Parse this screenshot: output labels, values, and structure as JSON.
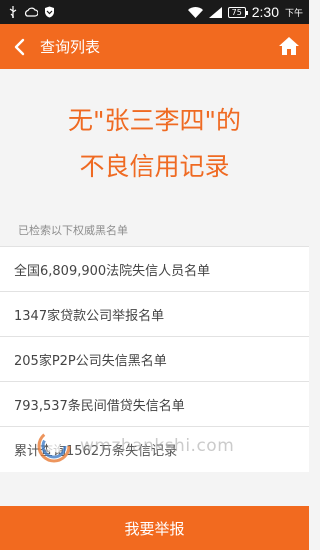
{
  "status_bar": {
    "battery": "75",
    "time": "2:30",
    "ampm": "下午"
  },
  "header": {
    "title": "查询列表"
  },
  "headline": {
    "line1": "无\"张三李四\"的",
    "line2": "不良信用记录"
  },
  "section_label": "已检索以下权威黑名单",
  "list_items": [
    "全国6,809,900法院失信人员名单",
    "1347家贷款公司举报名单",
    "205家P2P公司失信黑名单",
    "793,537条民间借贷失信名单",
    "累计查询1562万条失信记录"
  ],
  "watermark": {
    "text": "wmzhankshi.com"
  },
  "footer": {
    "report_label": "我要举报"
  },
  "colors": {
    "accent": "#f26a1f",
    "headline": "#ef6a22",
    "status_bar": "#1a1a1a",
    "background": "#f4f4f4"
  }
}
